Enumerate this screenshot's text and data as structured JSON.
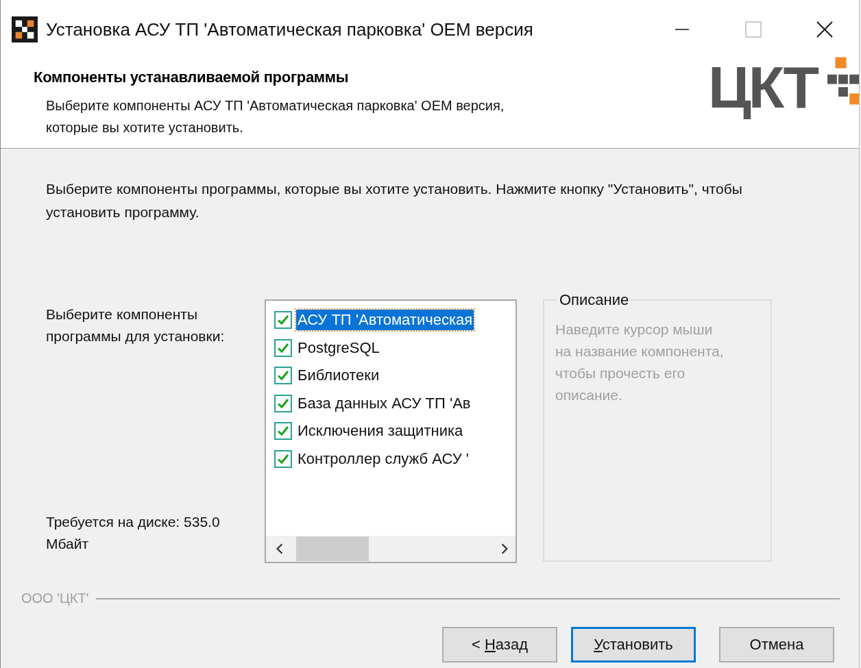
{
  "window": {
    "title": "Установка АСУ ТП 'Автоматическая парковка' OEM версия"
  },
  "header": {
    "title": "Компоненты устанавливаемой программы",
    "subtitle": "Выберите компоненты АСУ ТП 'Автоматическая парковка' OEM версия, которые вы хотите установить.",
    "logo": "ЦКТ"
  },
  "instruction": "Выберите компоненты программы, которые вы хотите установить. Нажмите кнопку \"Установить\", чтобы установить программу.",
  "components_label": "Выберите компоненты программы для установки:",
  "disk_space": "Требуется на диске: 535.0 Мбайт",
  "components": [
    {
      "label": "АСУ ТП 'Автоматическая",
      "checked": true,
      "selected": true
    },
    {
      "label": "PostgreSQL",
      "checked": true,
      "selected": false
    },
    {
      "label": "Библиотеки",
      "checked": true,
      "selected": false
    },
    {
      "label": "База данных АСУ ТП 'Ав",
      "checked": true,
      "selected": false
    },
    {
      "label": "Исключения защитника",
      "checked": true,
      "selected": false
    },
    {
      "label": "Контроллер служб АСУ '",
      "checked": true,
      "selected": false
    }
  ],
  "description": {
    "title": "Описание",
    "text": "Наведите курсор мыши на название компонента, чтобы прочесть его описание."
  },
  "branding": "ООО 'ЦКТ'",
  "buttons": [
    {
      "prefix": "< ",
      "access_key": "Н",
      "rest": "азад",
      "default": false
    },
    {
      "access_key": "У",
      "rest": "становить",
      "default": true
    },
    {
      "rest": "Отмена",
      "default": false
    }
  ]
}
